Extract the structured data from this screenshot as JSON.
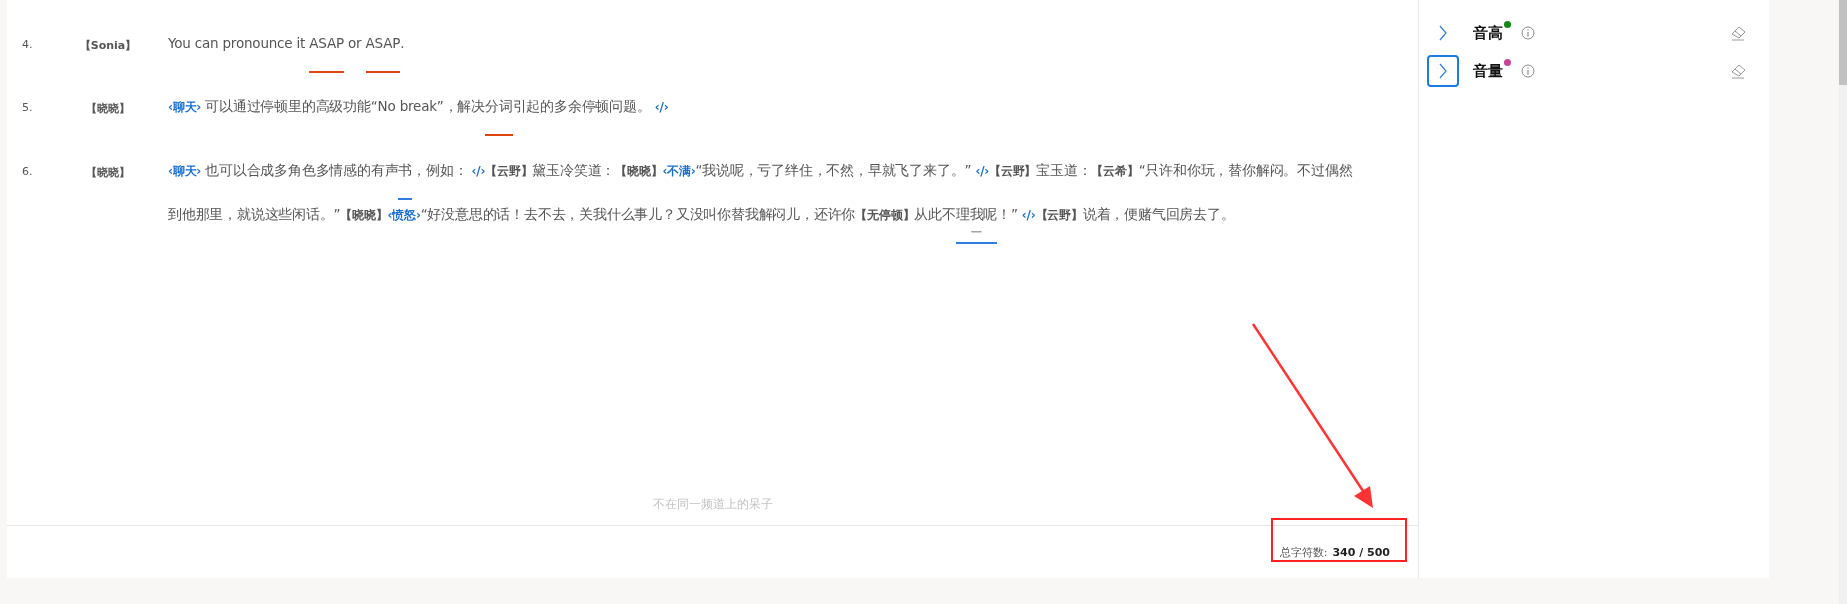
{
  "lines": [
    {
      "number": "4.",
      "speaker": "【Sonia】",
      "segments": [
        {
          "kind": "text",
          "text": "You can pronounce it "
        },
        {
          "kind": "text",
          "text": "ASAP",
          "color": "#e0440e"
        },
        {
          "kind": "text",
          "text": " or "
        },
        {
          "kind": "text",
          "text": "ASAP",
          "color": "#e0440e"
        },
        {
          "kind": "text",
          "text": "."
        }
      ]
    },
    {
      "number": "5.",
      "speaker": "【晓晓】",
      "segments": [
        {
          "kind": "tag",
          "text": "‹聊天›"
        },
        {
          "kind": "text",
          "text": " 可以通过停顿里的高级功能“No break”，解决"
        },
        {
          "kind": "text",
          "text": "分词",
          "color": "#e0440e"
        },
        {
          "kind": "text",
          "text": "引起的多余停顿问题。 "
        },
        {
          "kind": "close",
          "text": "‹/›"
        }
      ]
    },
    {
      "number": "6.",
      "speaker": "【晓晓】",
      "segments": [
        {
          "kind": "tag",
          "text": "‹聊天›"
        },
        {
          "kind": "text",
          "text": " 也可以合成多角色多情感的有声"
        },
        {
          "kind": "text",
          "text": "书",
          "color": "#2f7de1"
        },
        {
          "kind": "text",
          "text": "，例如： "
        },
        {
          "kind": "close",
          "text": "‹/›"
        },
        {
          "kind": "role",
          "text": "【云野】"
        },
        {
          "kind": "text",
          "text": "黛玉冷笑道："
        },
        {
          "kind": "role",
          "text": "【晓晓】"
        },
        {
          "kind": "tag",
          "text": "‹不满›"
        },
        {
          "kind": "text",
          "text": "“我说呢，亏了绊住，不然，早就飞了来了。” "
        },
        {
          "kind": "close",
          "text": "‹/›"
        },
        {
          "kind": "role",
          "text": "【云野】"
        },
        {
          "kind": "text",
          "text": "宝玉道："
        },
        {
          "kind": "role",
          "text": "【云希】"
        },
        {
          "kind": "text",
          "text": "“只许和你玩，替你解闷。不过偶然"
        },
        {
          "kind": "text",
          "text": "到他那里，就说这些闲话。”"
        },
        {
          "kind": "role",
          "text": "【晓晓】"
        },
        {
          "kind": "tag",
          "text": "‹愤怒›"
        },
        {
          "kind": "text",
          "text": "“好没意思的话！去不去，关我什么事儿？又没叫你替我解闷儿，还许你"
        },
        {
          "kind": "role",
          "text": "【无停顿】"
        },
        {
          "kind": "text",
          "text": "从此不"
        },
        {
          "kind": "text",
          "text": "理我呢",
          "color": "#2f7de1",
          "note": "一"
        },
        {
          "kind": "text",
          "text": "！” "
        },
        {
          "kind": "close",
          "text": "‹/›"
        },
        {
          "kind": "role",
          "text": "【云野】"
        },
        {
          "kind": "text",
          "text": "说着，便赌气回房去了。"
        }
      ]
    }
  ],
  "placeholder": "不在同一频道上的呆子",
  "counter": {
    "label": "总字符数:",
    "value": "340 / 500"
  },
  "annotations": {
    "arrow": true,
    "highlight_box": true
  },
  "panel_items": [
    {
      "label": "音高",
      "color": "#138a13",
      "selected": false
    },
    {
      "label": "音量",
      "color": "#c5449b",
      "selected": true
    }
  ]
}
